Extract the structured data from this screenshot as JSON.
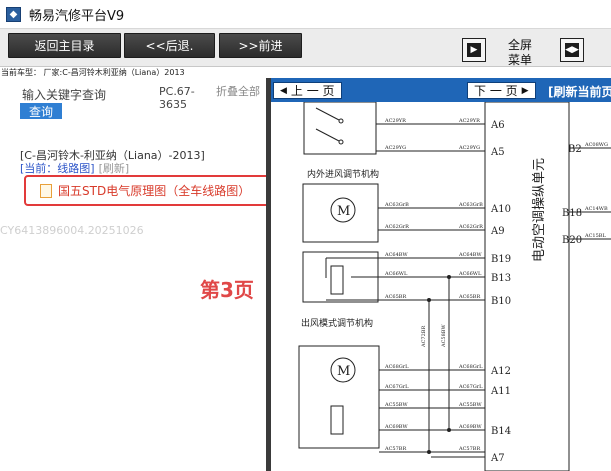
{
  "app": {
    "title": "畅易汽修平台V9"
  },
  "toolbar": {
    "home_label": "返回主目录",
    "back_label": "<<后退.",
    "forward_label": ">>前进",
    "fullscreen_label": "全屏\n菜单",
    "fullscreen_line1": "全屏",
    "fullscreen_line2": "菜单"
  },
  "breadcrumb": "当前车型： 厂家:C-昌河铃木利亚纳（Liana）2013",
  "sidebar": {
    "search_label": "输入关键字查询",
    "search_button": "查询",
    "pc_code": "PC.67-3635",
    "fold_all": "折叠全部",
    "vehicle": "[C-昌河铃木-利亚纳（Liana）-2013]",
    "current": "[当前：线路图]",
    "refresh": "[刷新]",
    "doc_item": "国五STD电气原理图（全车线路图）",
    "watermark": "CY6413896004.20251026",
    "page_note": "第3页"
  },
  "viewer": {
    "prev_label": "上 一 页",
    "next_label": "下 一 页",
    "refresh_label": "[刷新当前页"
  },
  "diagram": {
    "unit_title": "电动空调操纵单元",
    "label_recirc": "内外进风调节机构",
    "label_outlet": "出风模式调节机构",
    "motor_symbol": "M",
    "pins": [
      "A6",
      "A5",
      "A10",
      "A9",
      "B19",
      "B13",
      "B10",
      "A12",
      "A11",
      "B14",
      "A7"
    ],
    "right_pins": [
      "B2",
      "B18",
      "B20"
    ],
    "wire_left": [
      "AC29YR",
      "AC29YG",
      "AC63GrB",
      "AC62GrR",
      "AC64BW",
      "AC66WL",
      "AC65BR",
      "AC68GrL",
      "AC67GrL",
      "AC55BW",
      "AC69BW",
      "AC57BR"
    ],
    "wire_right": [
      "AC29YR",
      "AC29YG",
      "AC63GrB",
      "AC62GrR",
      "AC64BW",
      "AC66WL",
      "AC65BR",
      "AC68GrL",
      "AC67GrL",
      "AC55BW",
      "AC69BW",
      "AC57BR"
    ],
    "vertical_wires": [
      "AC72BR",
      "AC58BW"
    ],
    "far_right_wires": [
      "AC08WG",
      "AC14WB",
      "AC15BL"
    ]
  }
}
